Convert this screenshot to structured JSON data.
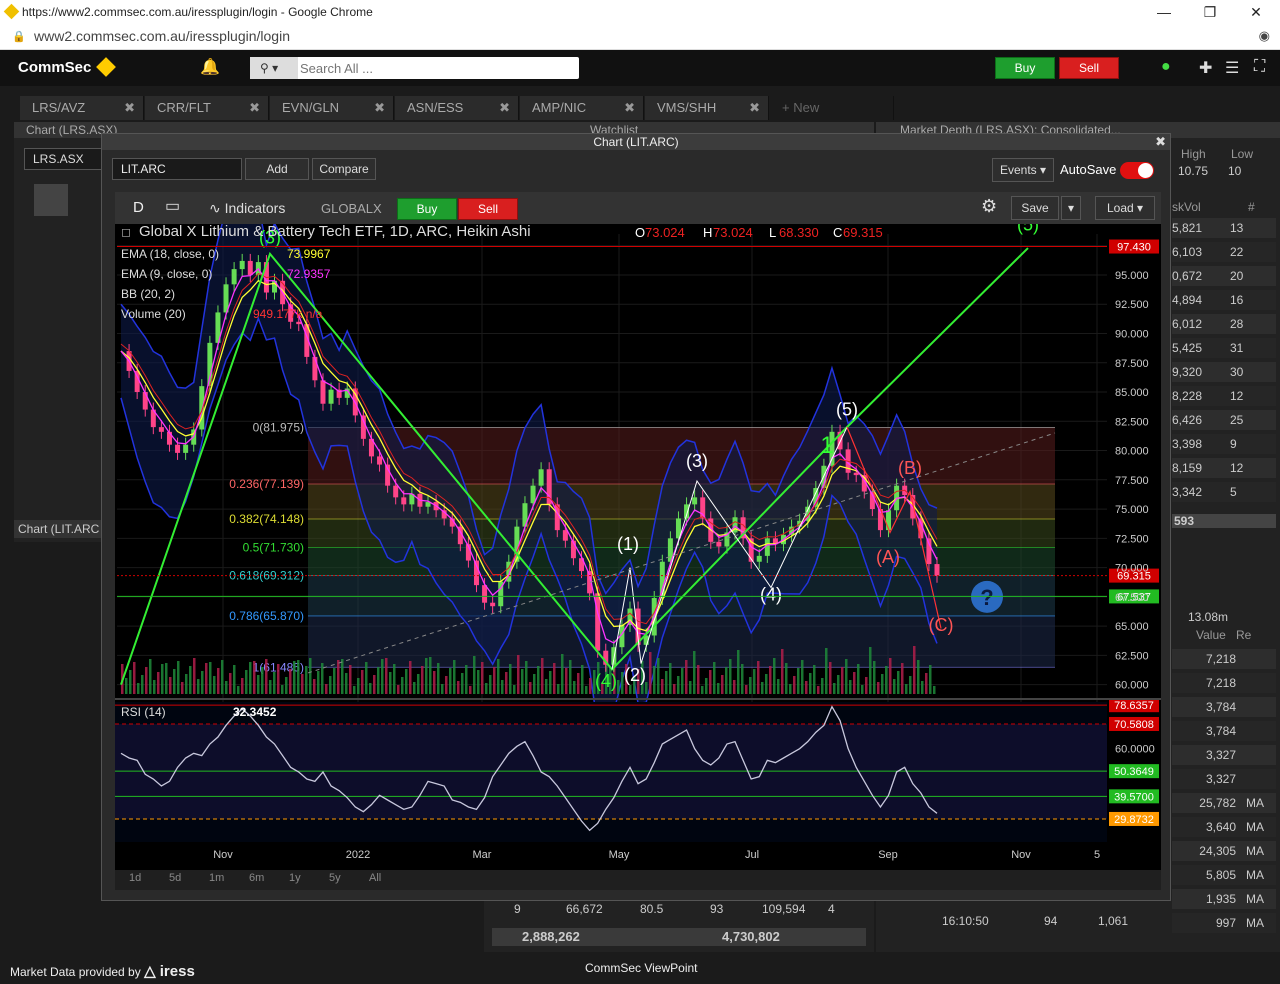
{
  "browser": {
    "title": "https://www2.commsec.com.au/iressplugin/login - Google Chrome",
    "url": "www2.commsec.com.au/iressplugin/login"
  },
  "header": {
    "logo": "CommSec",
    "search_placeholder": "Search All ...",
    "buy_label": "Buy",
    "sell_label": "Sell"
  },
  "tabs": [
    {
      "label": "LRS/AVZ"
    },
    {
      "label": "CRR/FLT"
    },
    {
      "label": "EVN/GLN"
    },
    {
      "label": "ASN/ESS"
    },
    {
      "label": "AMP/NIC"
    },
    {
      "label": "VMS/SHH"
    }
  ],
  "new_tab_label": "+ New",
  "background": {
    "chart_panel_title": "Chart (LRS.ASX)",
    "watchlist_title": "Watchlist",
    "depth_title": "Market Depth (LRS.ASX): Consolidated...",
    "left_symbol": "LRS.ASX",
    "left_caption": "Chart (LIT.ARC",
    "high_label": "High",
    "low_label": "Low",
    "high_value": "10.75",
    "low_value": "10",
    "askvol_header": "skVol",
    "hash_header": "#",
    "depth_rows": [
      {
        "vol": "5,821",
        "n": "13"
      },
      {
        "vol": "6,103",
        "n": "22"
      },
      {
        "vol": "0,672",
        "n": "20"
      },
      {
        "vol": "4,894",
        "n": "16"
      },
      {
        "vol": "6,012",
        "n": "28"
      },
      {
        "vol": "5,425",
        "n": "31"
      },
      {
        "vol": "9,320",
        "n": "30"
      },
      {
        "vol": "8,228",
        "n": "12"
      },
      {
        "vol": "6,426",
        "n": "25"
      },
      {
        "vol": "3,398",
        "n": "9"
      },
      {
        "vol": "8,159",
        "n": "12"
      },
      {
        "vol": "3,342",
        "n": "5"
      }
    ],
    "depth_total": "593",
    "course_value": "13.08m",
    "value_header": "Value",
    "re_header": "Re",
    "trade_rows": [
      {
        "v": "7,218",
        "f": ""
      },
      {
        "v": "7,218",
        "f": ""
      },
      {
        "v": "3,784",
        "f": ""
      },
      {
        "v": "3,784",
        "f": ""
      },
      {
        "v": "3,327",
        "f": ""
      },
      {
        "v": "3,327",
        "f": ""
      },
      {
        "v": "25,782",
        "f": "MA"
      },
      {
        "v": "3,640",
        "f": "MA"
      },
      {
        "v": "24,305",
        "f": "MA"
      },
      {
        "v": "5,805",
        "f": "MA"
      },
      {
        "v": "1,935",
        "f": "MA"
      },
      {
        "v": "997",
        "f": "MA"
      }
    ],
    "bottom_row": {
      "a": "9",
      "b": "66,672",
      "c": "80.5",
      "d": "93",
      "e": "109,594",
      "f": "4"
    },
    "bottom_totals": {
      "a": "2,888,262",
      "b": "4,730,802"
    },
    "trade_time": "16:10:50",
    "trade_qty": "94",
    "trade_px": "1,061"
  },
  "chart_window": {
    "title": "Chart (LIT.ARC)",
    "symbol": "LIT.ARC",
    "add_label": "Add",
    "compare_label": "Compare",
    "events_label": "Events",
    "autosave_label": "AutoSave",
    "interval_label": "D",
    "indicators_label": "Indicators",
    "exchange_label": "GLOBALX",
    "buy_label": "Buy",
    "sell_label": "Sell",
    "save_label": "Save",
    "load_label": "Load",
    "range_buttons": [
      "1d",
      "5d",
      "1m",
      "6m",
      "1y",
      "5y",
      "All"
    ]
  },
  "chart_data": [
    {
      "type": "candlestick",
      "title": "Global X Lithium & Battery Tech ETF, 1D, ARC, Heikin Ashi",
      "ohlc_readout": {
        "O": "73.024",
        "H": "73.024",
        "L": "68.330",
        "C": "69.315"
      },
      "legend": [
        {
          "label": "EMA (18, close, 0)",
          "value": "73.9967",
          "color": "#ffff33"
        },
        {
          "label": "EMA (9, close, 0)",
          "value": "72.9357",
          "color": "#ff33ff"
        },
        {
          "label": "BB (20, 2)",
          "value": "",
          "color": "#3344ff"
        },
        {
          "label": "Volume (20)",
          "value": "949.177k n/a",
          "color": "#ff3333"
        }
      ],
      "x_ticks": [
        "Nov",
        "2022",
        "Mar",
        "May",
        "Jul",
        "Sep",
        "Nov",
        "5"
      ],
      "y_ticks": [
        97.5,
        95,
        92.5,
        90,
        87.5,
        85,
        82.5,
        80,
        77.5,
        75,
        72.5,
        70,
        67.5,
        65,
        62.5,
        60
      ],
      "ylim": [
        59.2,
        98.5
      ],
      "price_labels": [
        {
          "value": "97.430",
          "color": "#d00000"
        },
        {
          "value": "69.315",
          "color": "#d00000"
        },
        {
          "value": "67.537",
          "color": "#22bb22"
        }
      ],
      "fibonacci": [
        {
          "label": "0(81.975)",
          "value": 81.975,
          "color": "#bbbbbb"
        },
        {
          "label": "0.236(77.139)",
          "value": 77.139,
          "color": "#ff6666"
        },
        {
          "label": "0.382(74.148)",
          "value": 74.148,
          "color": "#dddd33"
        },
        {
          "label": "0.5(71.730)",
          "value": 71.73,
          "color": "#33dd33"
        },
        {
          "label": "0.618(69.312)",
          "value": 69.312,
          "color": "#33cccc"
        },
        {
          "label": "0.786(65.870)",
          "value": 65.87,
          "color": "#3399ff"
        },
        {
          "label": "1(61.485)",
          "value": 61.485,
          "color": "#8888ff"
        }
      ],
      "wave_labels": [
        {
          "label": "(3)",
          "color": "#33ff33"
        },
        {
          "label": "(4)",
          "color": "#33ff33"
        },
        {
          "label": "(5)",
          "color": "#33ff33"
        },
        {
          "label": "1",
          "color": "#33ff33"
        },
        {
          "label": "(1)",
          "color": "#ffffff"
        },
        {
          "label": "(2)",
          "color": "#ffffff"
        },
        {
          "label": "(3)",
          "color": "#ffffff"
        },
        {
          "label": "(4)",
          "color": "#ffffff"
        },
        {
          "label": "(5)",
          "color": "#ffffff"
        },
        {
          "label": "(A)",
          "color": "#ff5555"
        },
        {
          "label": "(B)",
          "color": "#ff5555"
        },
        {
          "label": "(C)",
          "color": "#ff5555"
        }
      ],
      "close_path": [
        88.5,
        86.8,
        85.0,
        83.5,
        82.0,
        81.6,
        80.5,
        79.8,
        80.5,
        81.8,
        85.5,
        89.2,
        91.8,
        94.2,
        95.5,
        96.2,
        95.0,
        96.1,
        93.5,
        94.5,
        92.5,
        91.0,
        90.8,
        88.0,
        86.0,
        84.0,
        85.2,
        84.5,
        85.3,
        83.0,
        81.0,
        79.5,
        78.8,
        77.0,
        76.0,
        75.4,
        76.3,
        75.2,
        75.6,
        74.9,
        74.2,
        73.5,
        72.0,
        70.6,
        68.5,
        67.0,
        66.7,
        68.8,
        70.5,
        73.5,
        75.5,
        77.0,
        78.4,
        75.4,
        73.2,
        72.3,
        70.8,
        69.7,
        67.8,
        62.9,
        61.7,
        63.2,
        65.1,
        66.5,
        63.4,
        64.2,
        67.4,
        70.5,
        72.5,
        74.2,
        75.4,
        76.0,
        74.2,
        72.2,
        71.8,
        73.0,
        74.3,
        72.5,
        70.5,
        71.0,
        72.5,
        72.0,
        72.8,
        73.5,
        74.0,
        75.2,
        76.8,
        78.7,
        81.6,
        80.1,
        78.1,
        77.9,
        76.5,
        75.0,
        73.2,
        74.9,
        77.0,
        76.2,
        74.2,
        72.5,
        70.3,
        69.3
      ]
    },
    {
      "type": "line",
      "title": "RSI (14)",
      "current_value": "32.3452",
      "y_ticks": [
        60.0
      ],
      "levels": [
        {
          "value": "78.6357",
          "color": "#d00000"
        },
        {
          "value": "70.5808",
          "color": "#d00000"
        },
        {
          "value": "50.3649",
          "color": "#22bb22"
        },
        {
          "value": "39.5700",
          "color": "#22bb22"
        },
        {
          "value": "29.8732",
          "color": "#ff9900"
        }
      ],
      "ylim": [
        20,
        80
      ],
      "values": [
        58,
        56,
        55,
        49,
        47,
        44,
        46,
        52,
        56,
        58,
        57,
        62,
        65,
        70,
        74,
        77,
        74,
        70,
        65,
        62,
        57,
        52,
        50,
        47,
        46,
        50,
        44,
        42,
        39,
        35,
        33,
        36,
        40,
        38,
        36,
        34,
        35,
        40,
        46,
        45,
        44,
        38,
        37,
        35,
        34,
        39,
        48,
        53,
        58,
        61,
        63,
        57,
        50,
        48,
        44,
        39,
        34,
        29,
        25,
        28,
        34,
        39,
        46,
        52,
        45,
        47,
        54,
        62,
        64,
        66,
        68,
        60,
        55,
        53,
        56,
        62,
        63,
        55,
        47,
        48,
        55,
        54,
        56,
        58,
        60,
        63,
        67,
        70,
        78,
        72,
        60,
        52,
        46,
        40,
        35,
        40,
        50,
        52,
        45,
        41,
        35,
        32.3
      ]
    }
  ]
}
